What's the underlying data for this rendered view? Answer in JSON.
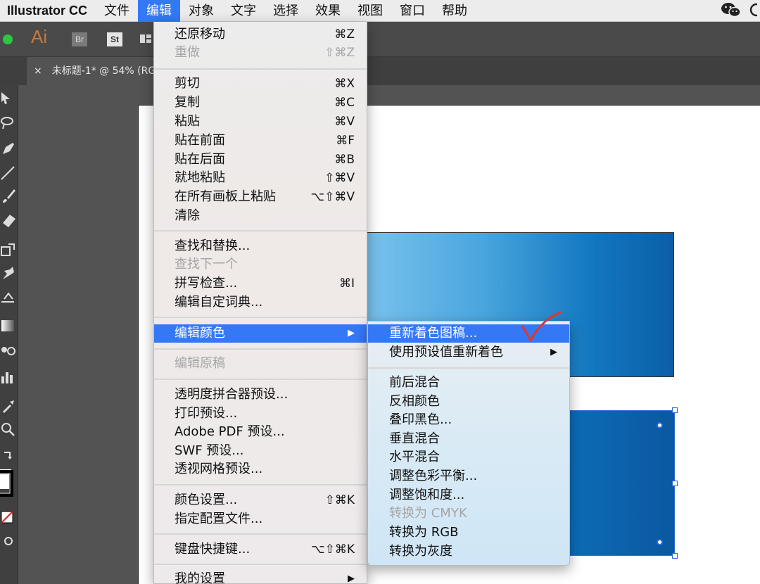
{
  "menubar": {
    "app_name": "Illustrator CC",
    "items": [
      "文件",
      "编辑",
      "对象",
      "文字",
      "选择",
      "效果",
      "视图",
      "窗口",
      "帮助"
    ],
    "active_index": 1
  },
  "appbar": {
    "logo": "Ai",
    "bridge": "Br",
    "stock": "St"
  },
  "document_tab": {
    "close": "×",
    "title": "未标题-1* @ 54% (RG"
  },
  "edit_menu": {
    "items": [
      {
        "label": "还原移动",
        "shortcut": "⌘Z",
        "disabled": false
      },
      {
        "label": "重做",
        "shortcut": "⇧⌘Z",
        "disabled": true
      },
      {
        "label": "剪切",
        "shortcut": "⌘X",
        "disabled": false
      },
      {
        "label": "复制",
        "shortcut": "⌘C",
        "disabled": false
      },
      {
        "label": "粘贴",
        "shortcut": "⌘V",
        "disabled": false
      },
      {
        "label": "贴在前面",
        "shortcut": "⌘F",
        "disabled": false
      },
      {
        "label": "贴在后面",
        "shortcut": "⌘B",
        "disabled": false
      },
      {
        "label": "就地粘贴",
        "shortcut": "⇧⌘V",
        "disabled": false
      },
      {
        "label": "在所有画板上粘贴",
        "shortcut": "⌥⇧⌘V",
        "disabled": false
      },
      {
        "label": "清除",
        "shortcut": "",
        "disabled": false
      },
      {
        "label": "查找和替换...",
        "shortcut": "",
        "disabled": false
      },
      {
        "label": "查找下一个",
        "shortcut": "",
        "disabled": true
      },
      {
        "label": "拼写检查...",
        "shortcut": "⌘I",
        "disabled": false
      },
      {
        "label": "编辑自定词典...",
        "shortcut": "",
        "disabled": false
      },
      {
        "label": "编辑颜色",
        "shortcut": "▶",
        "disabled": false
      },
      {
        "label": "编辑原稿",
        "shortcut": "",
        "disabled": true
      },
      {
        "label": "透明度拼合器预设...",
        "shortcut": "",
        "disabled": false
      },
      {
        "label": "打印预设...",
        "shortcut": "",
        "disabled": false
      },
      {
        "label": "Adobe PDF 预设...",
        "shortcut": "",
        "disabled": false
      },
      {
        "label": "SWF 预设...",
        "shortcut": "",
        "disabled": false
      },
      {
        "label": "透视网格预设...",
        "shortcut": "",
        "disabled": false
      },
      {
        "label": "颜色设置...",
        "shortcut": "⇧⌘K",
        "disabled": false
      },
      {
        "label": "指定配置文件...",
        "shortcut": "",
        "disabled": false
      },
      {
        "label": "键盘快捷键...",
        "shortcut": "⌥⇧⌘K",
        "disabled": false
      },
      {
        "label": "我的设置",
        "shortcut": "▶",
        "disabled": false
      }
    ]
  },
  "edit_colors_submenu": {
    "items": [
      {
        "label": "重新着色图稿...",
        "shortcut": "",
        "disabled": false
      },
      {
        "label": "使用预设值重新着色",
        "shortcut": "▶",
        "disabled": false
      },
      {
        "label": "前后混合",
        "shortcut": "",
        "disabled": false
      },
      {
        "label": "反相颜色",
        "shortcut": "",
        "disabled": false
      },
      {
        "label": "叠印黑色...",
        "shortcut": "",
        "disabled": false
      },
      {
        "label": "垂直混合",
        "shortcut": "",
        "disabled": false
      },
      {
        "label": "水平混合",
        "shortcut": "",
        "disabled": false
      },
      {
        "label": "调整色彩平衡...",
        "shortcut": "",
        "disabled": false
      },
      {
        "label": "调整饱和度...",
        "shortcut": "",
        "disabled": false
      },
      {
        "label": "转换为 CMYK",
        "shortcut": "",
        "disabled": true
      },
      {
        "label": "转换为 RGB",
        "shortcut": "",
        "disabled": false
      },
      {
        "label": "转换为灰度",
        "shortcut": "",
        "disabled": false
      }
    ]
  },
  "colors": {
    "highlight": "#3478f6",
    "check_mark": "#e8322c"
  }
}
